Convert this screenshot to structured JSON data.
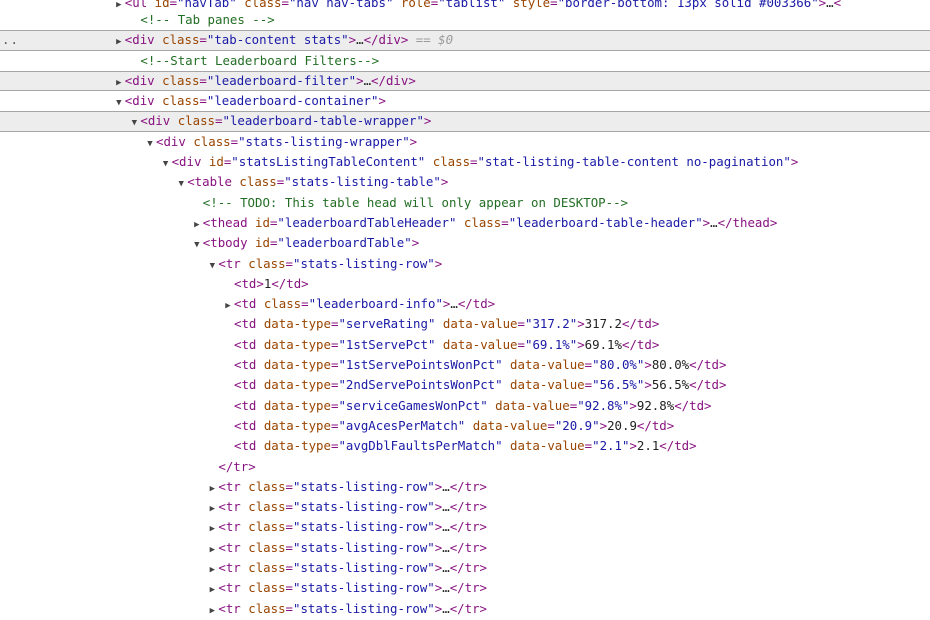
{
  "selected_marker": "== $0",
  "gutter_dots": "..",
  "lines": [
    {
      "indent": 8,
      "arrow": "right",
      "parts": [
        {
          "k": "tag",
          "t": "<ul "
        },
        {
          "k": "attr",
          "t": "id"
        },
        {
          "k": "tag",
          "t": "="
        },
        {
          "k": "val",
          "t": "\"navTab\""
        },
        {
          "k": "tag",
          "t": " "
        },
        {
          "k": "attr",
          "t": "class"
        },
        {
          "k": "tag",
          "t": "="
        },
        {
          "k": "val",
          "t": "\"nav nav-tabs\""
        },
        {
          "k": "tag",
          "t": " "
        },
        {
          "k": "attr",
          "t": "role"
        },
        {
          "k": "tag",
          "t": "="
        },
        {
          "k": "val",
          "t": "\"tablist\""
        },
        {
          "k": "tag",
          "t": " "
        },
        {
          "k": "attr",
          "t": "style"
        },
        {
          "k": "tag",
          "t": "="
        },
        {
          "k": "val",
          "t": "\"border-bottom: 13px solid #003366\""
        },
        {
          "k": "tag",
          "t": ">"
        },
        {
          "k": "text",
          "t": "…"
        },
        {
          "k": "tag",
          "t": "<"
        }
      ],
      "cls": "top"
    },
    {
      "indent": 9,
      "arrow": "none",
      "parts": [
        {
          "k": "comment",
          "t": "<!-- Tab panes -->"
        }
      ]
    },
    {
      "indent": 8,
      "arrow": "right",
      "hl": true,
      "selected": true,
      "parts": [
        {
          "k": "tag",
          "t": "<div "
        },
        {
          "k": "attr",
          "t": "class"
        },
        {
          "k": "tag",
          "t": "="
        },
        {
          "k": "val",
          "t": "\"tab-content stats\""
        },
        {
          "k": "tag",
          "t": ">"
        },
        {
          "k": "text",
          "t": "…"
        },
        {
          "k": "tag",
          "t": "</div>"
        }
      ]
    },
    {
      "indent": 9,
      "arrow": "none",
      "parts": [
        {
          "k": "comment",
          "t": "<!--Start Leaderboard Filters-->"
        }
      ]
    },
    {
      "indent": 8,
      "arrow": "right",
      "hl": true,
      "parts": [
        {
          "k": "tag",
          "t": "<div "
        },
        {
          "k": "attr",
          "t": "class"
        },
        {
          "k": "tag",
          "t": "="
        },
        {
          "k": "val",
          "t": "\"leaderboard-filter\""
        },
        {
          "k": "tag",
          "t": ">"
        },
        {
          "k": "text",
          "t": "…"
        },
        {
          "k": "tag",
          "t": "</div>"
        }
      ]
    },
    {
      "indent": 8,
      "arrow": "down",
      "parts": [
        {
          "k": "tag",
          "t": "<div "
        },
        {
          "k": "attr",
          "t": "class"
        },
        {
          "k": "tag",
          "t": "="
        },
        {
          "k": "val",
          "t": "\"leaderboard-container\""
        },
        {
          "k": "tag",
          "t": ">"
        }
      ]
    },
    {
      "indent": 9,
      "arrow": "down",
      "hl": true,
      "parts": [
        {
          "k": "tag",
          "t": "<div "
        },
        {
          "k": "attr",
          "t": "class"
        },
        {
          "k": "tag",
          "t": "="
        },
        {
          "k": "val",
          "t": "\"leaderboard-table-wrapper\""
        },
        {
          "k": "tag",
          "t": ">"
        }
      ]
    },
    {
      "indent": 10,
      "arrow": "down",
      "parts": [
        {
          "k": "tag",
          "t": "<div "
        },
        {
          "k": "attr",
          "t": "class"
        },
        {
          "k": "tag",
          "t": "="
        },
        {
          "k": "val",
          "t": "\"stats-listing-wrapper\""
        },
        {
          "k": "tag",
          "t": ">"
        }
      ]
    },
    {
      "indent": 11,
      "arrow": "down",
      "parts": [
        {
          "k": "tag",
          "t": "<div "
        },
        {
          "k": "attr",
          "t": "id"
        },
        {
          "k": "tag",
          "t": "="
        },
        {
          "k": "val",
          "t": "\"statsListingTableContent\""
        },
        {
          "k": "tag",
          "t": " "
        },
        {
          "k": "attr",
          "t": "class"
        },
        {
          "k": "tag",
          "t": "="
        },
        {
          "k": "val",
          "t": "\"stat-listing-table-content no-pagination\""
        },
        {
          "k": "tag",
          "t": ">"
        }
      ]
    },
    {
      "indent": 12,
      "arrow": "down",
      "parts": [
        {
          "k": "tag",
          "t": "<table "
        },
        {
          "k": "attr",
          "t": "class"
        },
        {
          "k": "tag",
          "t": "="
        },
        {
          "k": "val",
          "t": "\"stats-listing-table\""
        },
        {
          "k": "tag",
          "t": ">"
        }
      ]
    },
    {
      "indent": 13,
      "arrow": "none",
      "parts": [
        {
          "k": "comment",
          "t": "<!-- TODO: This table head will only appear on DESKTOP-->"
        }
      ]
    },
    {
      "indent": 13,
      "arrow": "right",
      "parts": [
        {
          "k": "tag",
          "t": "<thead "
        },
        {
          "k": "attr",
          "t": "id"
        },
        {
          "k": "tag",
          "t": "="
        },
        {
          "k": "val",
          "t": "\"leaderboardTableHeader\""
        },
        {
          "k": "tag",
          "t": " "
        },
        {
          "k": "attr",
          "t": "class"
        },
        {
          "k": "tag",
          "t": "="
        },
        {
          "k": "val",
          "t": "\"leaderboard-table-header\""
        },
        {
          "k": "tag",
          "t": ">"
        },
        {
          "k": "text",
          "t": "…"
        },
        {
          "k": "tag",
          "t": "</thead>"
        }
      ]
    },
    {
      "indent": 13,
      "arrow": "down",
      "parts": [
        {
          "k": "tag",
          "t": "<tbody "
        },
        {
          "k": "attr",
          "t": "id"
        },
        {
          "k": "tag",
          "t": "="
        },
        {
          "k": "val",
          "t": "\"leaderboardTable\""
        },
        {
          "k": "tag",
          "t": ">"
        }
      ]
    },
    {
      "indent": 14,
      "arrow": "down",
      "parts": [
        {
          "k": "tag",
          "t": "<tr "
        },
        {
          "k": "attr",
          "t": "class"
        },
        {
          "k": "tag",
          "t": "="
        },
        {
          "k": "val",
          "t": "\"stats-listing-row\""
        },
        {
          "k": "tag",
          "t": ">"
        }
      ]
    },
    {
      "indent": 15,
      "arrow": "none",
      "parts": [
        {
          "k": "tag",
          "t": "<td>"
        },
        {
          "k": "text",
          "t": "1"
        },
        {
          "k": "tag",
          "t": "</td>"
        }
      ]
    },
    {
      "indent": 15,
      "arrow": "right",
      "parts": [
        {
          "k": "tag",
          "t": "<td "
        },
        {
          "k": "attr",
          "t": "class"
        },
        {
          "k": "tag",
          "t": "="
        },
        {
          "k": "val",
          "t": "\"leaderboard-info\""
        },
        {
          "k": "tag",
          "t": ">"
        },
        {
          "k": "text",
          "t": "…"
        },
        {
          "k": "tag",
          "t": "</td>"
        }
      ]
    },
    {
      "indent": 15,
      "arrow": "none",
      "parts": [
        {
          "k": "tag",
          "t": "<td "
        },
        {
          "k": "attr",
          "t": "data-type"
        },
        {
          "k": "tag",
          "t": "="
        },
        {
          "k": "val",
          "t": "\"serveRating\""
        },
        {
          "k": "tag",
          "t": " "
        },
        {
          "k": "attr",
          "t": "data-value"
        },
        {
          "k": "tag",
          "t": "="
        },
        {
          "k": "val",
          "t": "\"317.2\""
        },
        {
          "k": "tag",
          "t": ">"
        },
        {
          "k": "text",
          "t": "317.2"
        },
        {
          "k": "tag",
          "t": "</td>"
        }
      ]
    },
    {
      "indent": 15,
      "arrow": "none",
      "parts": [
        {
          "k": "tag",
          "t": "<td "
        },
        {
          "k": "attr",
          "t": "data-type"
        },
        {
          "k": "tag",
          "t": "="
        },
        {
          "k": "val",
          "t": "\"1stServePct\""
        },
        {
          "k": "tag",
          "t": " "
        },
        {
          "k": "attr",
          "t": "data-value"
        },
        {
          "k": "tag",
          "t": "="
        },
        {
          "k": "val",
          "t": "\"69.1%\""
        },
        {
          "k": "tag",
          "t": ">"
        },
        {
          "k": "text",
          "t": "69.1%"
        },
        {
          "k": "tag",
          "t": "</td>"
        }
      ]
    },
    {
      "indent": 15,
      "arrow": "none",
      "parts": [
        {
          "k": "tag",
          "t": "<td "
        },
        {
          "k": "attr",
          "t": "data-type"
        },
        {
          "k": "tag",
          "t": "="
        },
        {
          "k": "val",
          "t": "\"1stServePointsWonPct\""
        },
        {
          "k": "tag",
          "t": " "
        },
        {
          "k": "attr",
          "t": "data-value"
        },
        {
          "k": "tag",
          "t": "="
        },
        {
          "k": "val",
          "t": "\"80.0%\""
        },
        {
          "k": "tag",
          "t": ">"
        },
        {
          "k": "text",
          "t": "80.0%"
        },
        {
          "k": "tag",
          "t": "</td>"
        }
      ]
    },
    {
      "indent": 15,
      "arrow": "none",
      "parts": [
        {
          "k": "tag",
          "t": "<td "
        },
        {
          "k": "attr",
          "t": "data-type"
        },
        {
          "k": "tag",
          "t": "="
        },
        {
          "k": "val",
          "t": "\"2ndServePointsWonPct\""
        },
        {
          "k": "tag",
          "t": " "
        },
        {
          "k": "attr",
          "t": "data-value"
        },
        {
          "k": "tag",
          "t": "="
        },
        {
          "k": "val",
          "t": "\"56.5%\""
        },
        {
          "k": "tag",
          "t": ">"
        },
        {
          "k": "text",
          "t": "56.5%"
        },
        {
          "k": "tag",
          "t": "</td>"
        }
      ]
    },
    {
      "indent": 15,
      "arrow": "none",
      "parts": [
        {
          "k": "tag",
          "t": "<td "
        },
        {
          "k": "attr",
          "t": "data-type"
        },
        {
          "k": "tag",
          "t": "="
        },
        {
          "k": "val",
          "t": "\"serviceGamesWonPct\""
        },
        {
          "k": "tag",
          "t": " "
        },
        {
          "k": "attr",
          "t": "data-value"
        },
        {
          "k": "tag",
          "t": "="
        },
        {
          "k": "val",
          "t": "\"92.8%\""
        },
        {
          "k": "tag",
          "t": ">"
        },
        {
          "k": "text",
          "t": "92.8%"
        },
        {
          "k": "tag",
          "t": "</td>"
        }
      ]
    },
    {
      "indent": 15,
      "arrow": "none",
      "parts": [
        {
          "k": "tag",
          "t": "<td "
        },
        {
          "k": "attr",
          "t": "data-type"
        },
        {
          "k": "tag",
          "t": "="
        },
        {
          "k": "val",
          "t": "\"avgAcesPerMatch\""
        },
        {
          "k": "tag",
          "t": " "
        },
        {
          "k": "attr",
          "t": "data-value"
        },
        {
          "k": "tag",
          "t": "="
        },
        {
          "k": "val",
          "t": "\"20.9\""
        },
        {
          "k": "tag",
          "t": ">"
        },
        {
          "k": "text",
          "t": "20.9"
        },
        {
          "k": "tag",
          "t": "</td>"
        }
      ]
    },
    {
      "indent": 15,
      "arrow": "none",
      "parts": [
        {
          "k": "tag",
          "t": "<td "
        },
        {
          "k": "attr",
          "t": "data-type"
        },
        {
          "k": "tag",
          "t": "="
        },
        {
          "k": "val",
          "t": "\"avgDblFaultsPerMatch\""
        },
        {
          "k": "tag",
          "t": " "
        },
        {
          "k": "attr",
          "t": "data-value"
        },
        {
          "k": "tag",
          "t": "="
        },
        {
          "k": "val",
          "t": "\"2.1\""
        },
        {
          "k": "tag",
          "t": ">"
        },
        {
          "k": "text",
          "t": "2.1"
        },
        {
          "k": "tag",
          "t": "</td>"
        }
      ]
    },
    {
      "indent": 14,
      "arrow": "none",
      "parts": [
        {
          "k": "tag",
          "t": "</tr>"
        }
      ]
    },
    {
      "indent": 14,
      "arrow": "right",
      "parts": [
        {
          "k": "tag",
          "t": "<tr "
        },
        {
          "k": "attr",
          "t": "class"
        },
        {
          "k": "tag",
          "t": "="
        },
        {
          "k": "val",
          "t": "\"stats-listing-row\""
        },
        {
          "k": "tag",
          "t": ">"
        },
        {
          "k": "text",
          "t": "…"
        },
        {
          "k": "tag",
          "t": "</tr>"
        }
      ]
    },
    {
      "indent": 14,
      "arrow": "right",
      "parts": [
        {
          "k": "tag",
          "t": "<tr "
        },
        {
          "k": "attr",
          "t": "class"
        },
        {
          "k": "tag",
          "t": "="
        },
        {
          "k": "val",
          "t": "\"stats-listing-row\""
        },
        {
          "k": "tag",
          "t": ">"
        },
        {
          "k": "text",
          "t": "…"
        },
        {
          "k": "tag",
          "t": "</tr>"
        }
      ]
    },
    {
      "indent": 14,
      "arrow": "right",
      "parts": [
        {
          "k": "tag",
          "t": "<tr "
        },
        {
          "k": "attr",
          "t": "class"
        },
        {
          "k": "tag",
          "t": "="
        },
        {
          "k": "val",
          "t": "\"stats-listing-row\""
        },
        {
          "k": "tag",
          "t": ">"
        },
        {
          "k": "text",
          "t": "…"
        },
        {
          "k": "tag",
          "t": "</tr>"
        }
      ]
    },
    {
      "indent": 14,
      "arrow": "right",
      "parts": [
        {
          "k": "tag",
          "t": "<tr "
        },
        {
          "k": "attr",
          "t": "class"
        },
        {
          "k": "tag",
          "t": "="
        },
        {
          "k": "val",
          "t": "\"stats-listing-row\""
        },
        {
          "k": "tag",
          "t": ">"
        },
        {
          "k": "text",
          "t": "…"
        },
        {
          "k": "tag",
          "t": "</tr>"
        }
      ]
    },
    {
      "indent": 14,
      "arrow": "right",
      "parts": [
        {
          "k": "tag",
          "t": "<tr "
        },
        {
          "k": "attr",
          "t": "class"
        },
        {
          "k": "tag",
          "t": "="
        },
        {
          "k": "val",
          "t": "\"stats-listing-row\""
        },
        {
          "k": "tag",
          "t": ">"
        },
        {
          "k": "text",
          "t": "…"
        },
        {
          "k": "tag",
          "t": "</tr>"
        }
      ]
    },
    {
      "indent": 14,
      "arrow": "right",
      "parts": [
        {
          "k": "tag",
          "t": "<tr "
        },
        {
          "k": "attr",
          "t": "class"
        },
        {
          "k": "tag",
          "t": "="
        },
        {
          "k": "val",
          "t": "\"stats-listing-row\""
        },
        {
          "k": "tag",
          "t": ">"
        },
        {
          "k": "text",
          "t": "…"
        },
        {
          "k": "tag",
          "t": "</tr>"
        }
      ]
    },
    {
      "indent": 14,
      "arrow": "right",
      "parts": [
        {
          "k": "tag",
          "t": "<tr "
        },
        {
          "k": "attr",
          "t": "class"
        },
        {
          "k": "tag",
          "t": "="
        },
        {
          "k": "val",
          "t": "\"stats-listing-row\""
        },
        {
          "k": "tag",
          "t": ">"
        },
        {
          "k": "text",
          "t": "…"
        },
        {
          "k": "tag",
          "t": "</tr>"
        }
      ]
    }
  ]
}
